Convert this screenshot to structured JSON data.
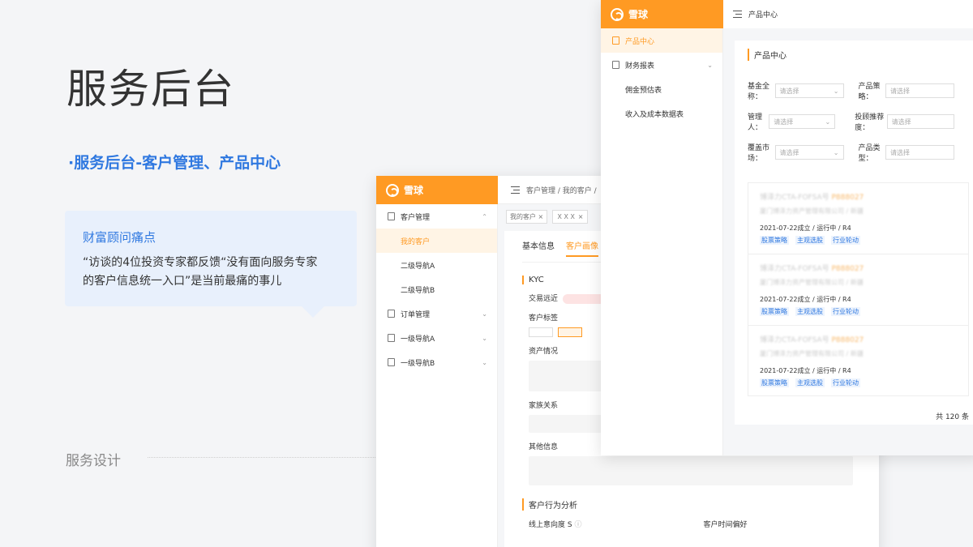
{
  "slide": {
    "title": "服务后台",
    "subtitle": "·服务后台-客户管理、产品中心",
    "pain_title": "财富顾问痛点",
    "pain_text_line1": "“访谈的4位投资专家都反馈“没有面向服务专家",
    "pain_text_line2": "的客户信息统一入口”是当前最痛的事儿",
    "footer": "服务设计"
  },
  "brand": {
    "logo_text": "雪球",
    "accent": "#ff9a23",
    "link": "#2f78e0"
  },
  "customer_window": {
    "breadcrumb": "客户管理  /  我的客户  /",
    "tags": [
      "我的客户 ×",
      "ＸＸＸ ×"
    ],
    "nav": [
      {
        "label": "客户管理",
        "chevron": "⌃"
      },
      {
        "label": "我的客户"
      },
      {
        "label": "二级导航A"
      },
      {
        "label": "二级导航B"
      },
      {
        "label": "订单管理",
        "chevron": "⌄"
      },
      {
        "label": "一级导航A",
        "chevron": "⌄"
      },
      {
        "label": "一级导航B",
        "chevron": "⌄"
      }
    ],
    "tabs": [
      "基本信息",
      "客户画像"
    ],
    "kyc_title": "KYC",
    "trade_label": "交易远近",
    "tag_label": "客户标签",
    "asset_label": "资产情况",
    "family_label": "家族关系",
    "other_label": "其他信息",
    "behavior_title": "客户行为分析",
    "online_label": "线上意向度",
    "online_value": "S",
    "time_pref_label": "客户时间偏好"
  },
  "product_window": {
    "topbar_title": "产品中心",
    "nav": [
      {
        "label": "产品中心"
      },
      {
        "label": "财务报表",
        "chevron": "⌄"
      },
      {
        "label": "佣金预估表"
      },
      {
        "label": "收入及成本数据表"
      }
    ],
    "panel_title": "产品中心",
    "filters": [
      {
        "label": "基金全称：",
        "placeholder": "请选择"
      },
      {
        "label": "产品策略：",
        "placeholder": "请选择"
      },
      {
        "label": "管理人：",
        "placeholder": "请选择"
      },
      {
        "label": "投顾推荐度：",
        "placeholder": "请选择"
      },
      {
        "label": "覆盖市场：",
        "placeholder": "请选择"
      },
      {
        "label": "产品类型：",
        "placeholder": "请选择"
      }
    ],
    "cards": [
      {
        "name": "博泽力CTA-FOFSA号",
        "code": "P888027",
        "company": "厦门博泽力资产管理有限公司 / 新疆",
        "meta": "2021-07-22成立 / 运行中 / R4",
        "links": [
          "股票策略",
          "主观选股",
          "行业轮动"
        ]
      },
      {
        "name": "博泽力CTA-FOFSA号",
        "code": "P888027",
        "company": "厦门博泽力资产管理有限公司 / 新疆",
        "meta": "2021-07-22成立 / 运行中 / R4",
        "links": [
          "股票策略",
          "主观选股",
          "行业轮动"
        ]
      },
      {
        "name": "博泽力CTA-FOFSA号",
        "code": "P888027",
        "company": "厦门博泽力资产管理有限公司 / 新疆",
        "meta": "2021-07-22成立 / 运行中 / R4",
        "links": [
          "股票策略",
          "主观选股",
          "行业轮动"
        ]
      }
    ],
    "total": "共 120 条"
  }
}
